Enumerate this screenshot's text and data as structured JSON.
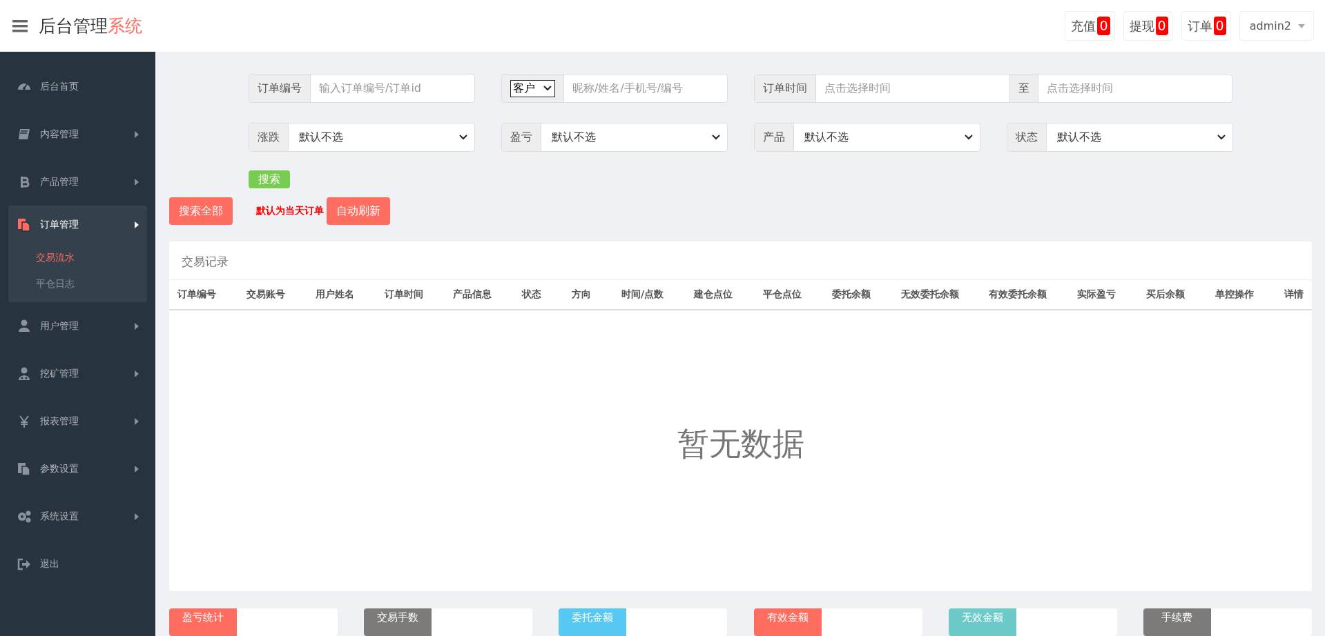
{
  "header": {
    "title": "后台管理",
    "title_accent": "系统",
    "counters": [
      {
        "label": "充值",
        "count": "0"
      },
      {
        "label": "提现",
        "count": "0"
      },
      {
        "label": "订单",
        "count": "0"
      }
    ],
    "user": "admin2"
  },
  "sidebar": {
    "items": [
      {
        "kind": "link",
        "label": "后台首页",
        "selected": false
      },
      {
        "kind": "group",
        "label": "内容管理",
        "expanded": false,
        "selected": false
      },
      {
        "kind": "group",
        "label": "产品管理",
        "expanded": false,
        "selected": false
      },
      {
        "kind": "group",
        "label": "订单管理",
        "expanded": true,
        "selected": true,
        "children": [
          {
            "label": "交易流水",
            "selected": true
          },
          {
            "label": "平仓日志",
            "selected": false
          }
        ]
      },
      {
        "kind": "group",
        "label": "用户管理",
        "expanded": false,
        "selected": false
      },
      {
        "kind": "group",
        "label": "挖矿管理",
        "expanded": false,
        "selected": false
      },
      {
        "kind": "group",
        "label": "报表管理",
        "expanded": false,
        "selected": false
      },
      {
        "kind": "group",
        "label": "参数设置",
        "expanded": false,
        "selected": false
      },
      {
        "kind": "group",
        "label": "系统设置",
        "expanded": false,
        "selected": false
      },
      {
        "kind": "link",
        "label": "退出",
        "selected": false
      }
    ]
  },
  "filters": {
    "row_1": [
      {
        "kind": "text",
        "label": "订单编号",
        "placeholder": "输入订单编号/订单id"
      },
      {
        "kind": "picker",
        "option": "客户",
        "placeholder": "昵称/姓名/手机号/编号"
      },
      {
        "kind": "range",
        "label": "订单时间",
        "placeholder": "点击选择时间",
        "separator": "至",
        "placeholder_2": "点击选择时间"
      }
    ],
    "row_2": [
      {
        "label": "涨跌",
        "value": "默认不选"
      },
      {
        "label": "盈亏",
        "value": "默认不选"
      },
      {
        "label": "产品",
        "value": "默认不选"
      },
      {
        "label": "状态",
        "value": "默认不选"
      }
    ],
    "search_button": "搜索"
  },
  "actions": {
    "search_all": "搜索全部",
    "note": "默认为当天订单",
    "auto_refresh": "自动刷新"
  },
  "table": {
    "title": "交易记录",
    "columns": [
      "订单编号",
      "交易账号",
      "用户姓名",
      "订单时间",
      "产品信息",
      "状态",
      "方向",
      "时间/点数",
      "建仓点位",
      "平仓点位",
      "委托余额",
      "无效委托余额",
      "有效委托余额",
      "实际盈亏",
      "买后余额",
      "单控操作",
      "详情"
    ],
    "empty_text": "暂无数据"
  },
  "stats": [
    {
      "label": "盈亏统计",
      "color": "#ff6c60"
    },
    {
      "label": "交易手数",
      "color": "#7d7b7a"
    },
    {
      "label": "委托金额",
      "color": "#57c8f2"
    },
    {
      "label": "有效金额",
      "color": "#ff6c60"
    },
    {
      "label": "无效金额",
      "color": "#6ccac9"
    },
    {
      "label": "手续费",
      "color": "#7d7b7a"
    }
  ]
}
